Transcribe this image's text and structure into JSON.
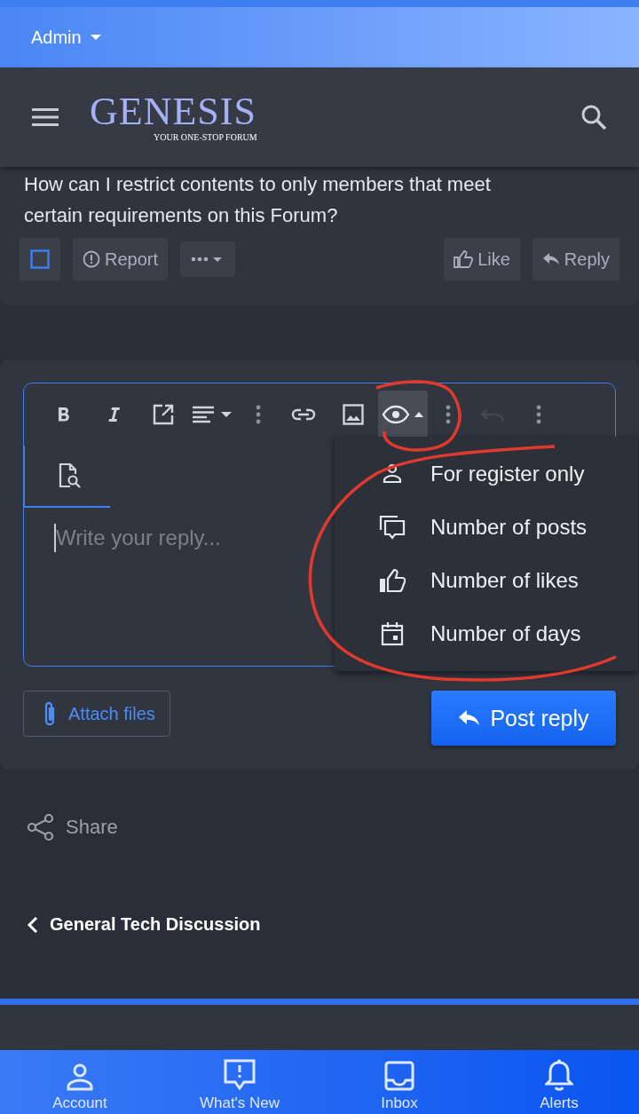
{
  "top_bar": {
    "user": "Admin"
  },
  "header": {
    "logo": "GENESIS",
    "tagline": "YOUR ONE-STOP FORUM"
  },
  "post": {
    "text_lines": [
      "How can I restrict contents to only members that meet",
      "certain requirements on this Forum?"
    ],
    "selected": false,
    "report": "Report",
    "like": "Like",
    "reply": "Reply"
  },
  "editor": {
    "toolbar": [
      {
        "kind": "bold",
        "expanded": false,
        "disabled": false
      },
      {
        "kind": "italic",
        "expanded": false,
        "disabled": false
      },
      {
        "kind": "external",
        "expanded": false,
        "disabled": false
      },
      {
        "kind": "align",
        "expanded": false,
        "disabled": false
      },
      {
        "kind": "more",
        "expanded": false,
        "disabled": false
      },
      {
        "kind": "link",
        "expanded": false,
        "disabled": false
      },
      {
        "kind": "image",
        "expanded": false,
        "disabled": false
      },
      {
        "kind": "hide",
        "expanded": true,
        "disabled": false
      },
      {
        "kind": "more",
        "expanded": false,
        "disabled": false
      },
      {
        "kind": "undo",
        "expanded": false,
        "disabled": true
      },
      {
        "kind": "more",
        "expanded": false,
        "disabled": false
      }
    ],
    "placeholder": "Write your reply...",
    "menu": [
      {
        "kind": "person",
        "label": "For register only"
      },
      {
        "kind": "posts",
        "label": "Number of posts"
      },
      {
        "kind": "likes",
        "label": "Number of likes"
      },
      {
        "kind": "days",
        "label": "Number of days"
      }
    ],
    "attach": "Attach files",
    "submit": "Post reply"
  },
  "share": "Share",
  "breadcrumb": "General Tech Discussion",
  "bottom_nav": [
    {
      "kind": "account",
      "label": "Account"
    },
    {
      "kind": "new",
      "label": "What's New"
    },
    {
      "kind": "inbox",
      "label": "Inbox"
    },
    {
      "kind": "alerts",
      "label": "Alerts"
    }
  ]
}
